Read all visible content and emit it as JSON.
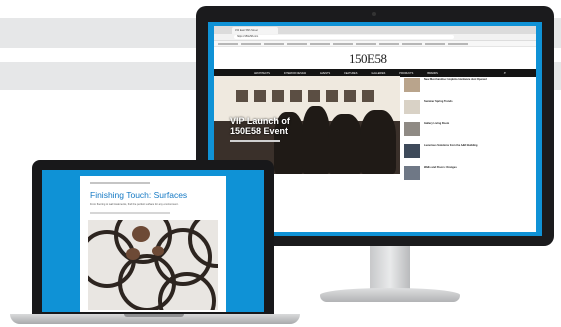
{
  "monitor": {
    "tab_label": "150 East 58th Street",
    "address_url": "https://150e58.com",
    "logo": "150E58",
    "nav_items": [
      "ARCHITECTS",
      "INTERIOR DESIGN",
      "EVENTS",
      "FEATURES",
      "GALLERIES",
      "PRODUCTS",
      "BRANDS"
    ],
    "hero": {
      "title_line1": "VIP Launch of",
      "title_line2": "150E58 Event"
    },
    "sidebar_items": [
      "New Merchandise: Hopkins Hardware Just Opened",
      "Summer Spring Trends",
      "Gallery Living Room",
      "Luxurious Solutions from the A&D Building",
      "Walls and Floors: Oranges"
    ]
  },
  "laptop": {
    "article_title": "Finishing Touch: Surfaces",
    "article_subtitle": "From flooring to wall treatments, find the perfect surface for any environment."
  },
  "colors": {
    "screen_blue": "#0f92d6",
    "title_blue": "#1479c4",
    "nav_black": "#141414"
  }
}
